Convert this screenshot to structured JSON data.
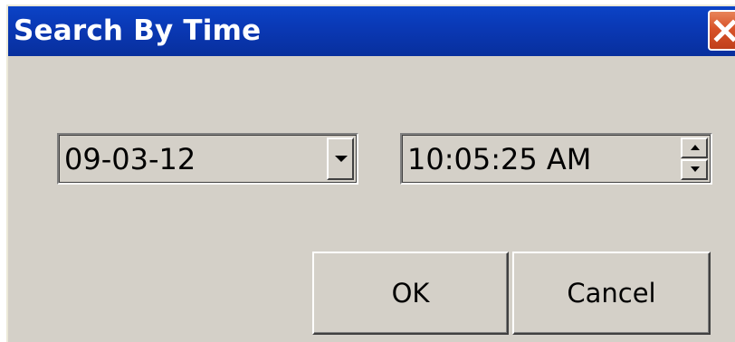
{
  "window": {
    "title": "Search By Time",
    "close_icon": "close-icon"
  },
  "date_picker": {
    "value": "09-03-12",
    "dropdown_icon": "chevron-down-icon"
  },
  "time_picker": {
    "value": "10:05:25 AM",
    "up_icon": "spin-up-icon",
    "down_icon": "spin-down-icon"
  },
  "buttons": {
    "ok_label": "OK",
    "cancel_label": "Cancel"
  },
  "colors": {
    "title_bar": "#0a39b6",
    "close_button": "#d8532a",
    "dialog_background": "#d4d0c8"
  }
}
